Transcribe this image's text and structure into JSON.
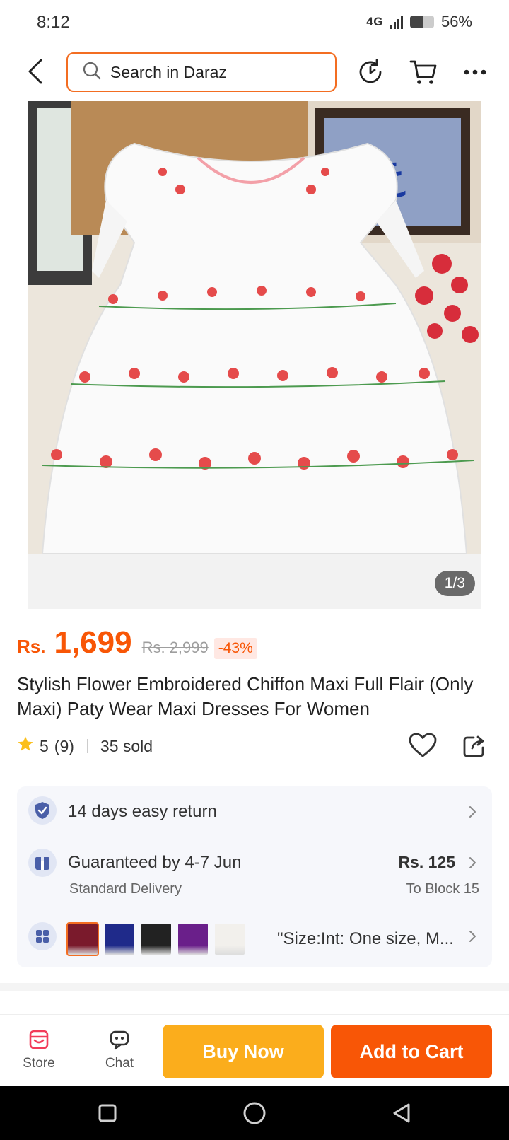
{
  "status_bar": {
    "time": "8:12",
    "network": "4G",
    "battery": "56%",
    "battery_level": 0.56
  },
  "top_nav": {
    "search_placeholder": "Search in Daraz",
    "icons": [
      "back-arrow-icon",
      "search-icon",
      "history-icon",
      "cart-icon",
      "more-icon"
    ]
  },
  "gallery": {
    "counter": "1/3"
  },
  "price": {
    "currency": "Rs.",
    "current": "1,699",
    "original": "Rs. 2,999",
    "discount": "-43%"
  },
  "product": {
    "title": "Stylish Flower Embroidered Chiffon Maxi Full Flair (Only Maxi) Paty Wear Maxi Dresses For Women"
  },
  "rating": {
    "score": "5",
    "count": "(9)",
    "sold": "35 sold"
  },
  "info": {
    "return": "14 days easy return",
    "delivery_title": "Guaranteed by 4-7 Jun",
    "delivery_sub": "Standard Delivery",
    "fee": "Rs. 125",
    "location": "To Block 15",
    "variant_text": "\"Size:Int: One size, M..."
  },
  "variants": [
    {
      "color": "#7a1a2c"
    },
    {
      "color": "#1f2a8a"
    },
    {
      "color": "#222222"
    },
    {
      "color": "#6a1f8a"
    },
    {
      "color": "#f2f0ec"
    }
  ],
  "bottom_bar": {
    "store": "Store",
    "chat": "Chat",
    "buy_now": "Buy Now",
    "add_to_cart": "Add to Cart"
  },
  "colors": {
    "accent": "#f85606",
    "buy_now": "#fbad1c",
    "search_border": "#f36d21"
  }
}
